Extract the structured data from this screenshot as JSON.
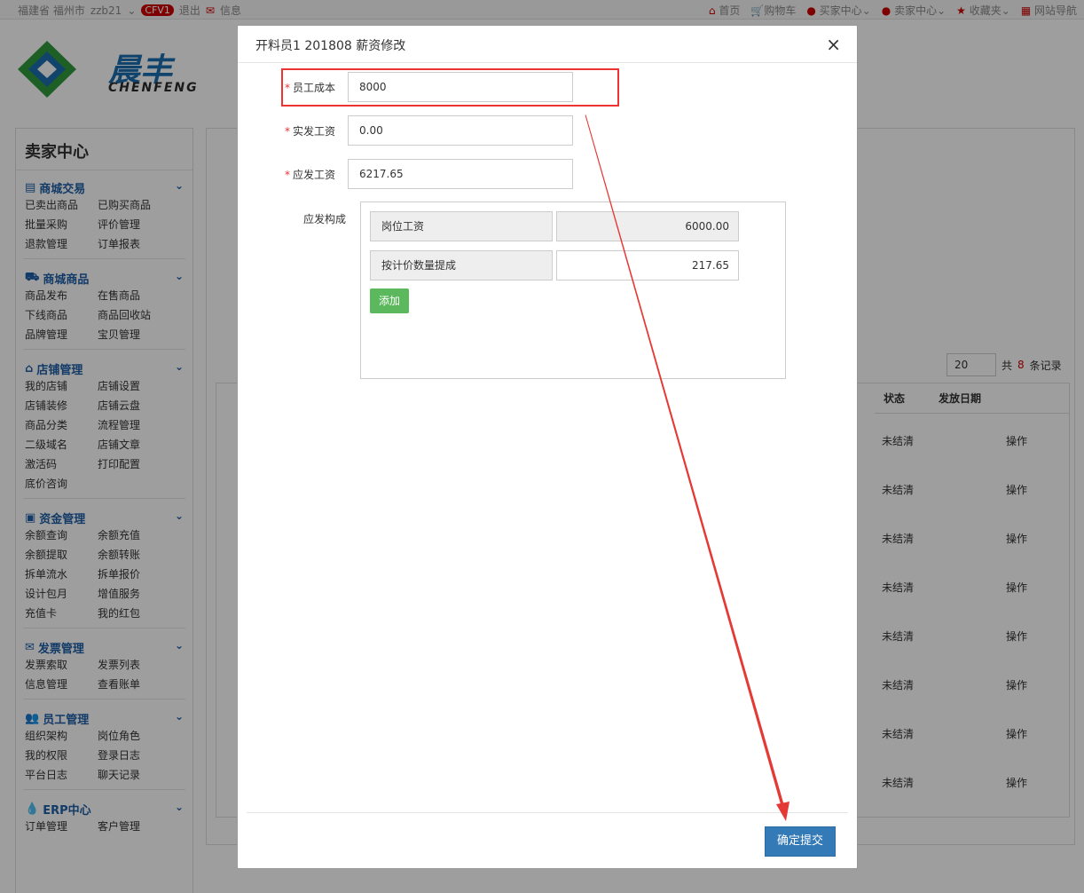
{
  "topbar": {
    "location": "福建省 福州市",
    "user": "zzb21",
    "level": "CFV1",
    "logout": "退出",
    "messages": "信息",
    "right_links": [
      "首页",
      "购物车",
      "买家中心",
      "卖家中心",
      "收藏夹",
      "网站导航"
    ]
  },
  "logo": {
    "cn": "晨丰",
    "en": "CHENFENG"
  },
  "sidebar": {
    "title": "卖家中心",
    "sections": [
      {
        "title": "商城交易",
        "icon": "list-icon",
        "items": [
          "已卖出商品",
          "已购买商品",
          "批量采购",
          "评价管理",
          "退款管理",
          "订单报表"
        ]
      },
      {
        "title": "商城商品",
        "icon": "truck-icon",
        "items": [
          "商品发布",
          "在售商品",
          "下线商品",
          "商品回收站",
          "品牌管理",
          "宝贝管理"
        ]
      },
      {
        "title": "店铺管理",
        "icon": "home-icon",
        "items": [
          "我的店铺",
          "店铺设置",
          "店铺装修",
          "店铺云盘",
          "商品分类",
          "流程管理",
          "二级域名",
          "店铺文章",
          "激活码",
          "打印配置",
          "底价咨询"
        ]
      },
      {
        "title": "资金管理",
        "icon": "money-icon",
        "items": [
          "余额查询",
          "余额充值",
          "余额提取",
          "余额转账",
          "拆单流水",
          "拆单报价",
          "设计包月",
          "增值服务",
          "充值卡",
          "我的红包"
        ]
      },
      {
        "title": "发票管理",
        "icon": "envelope-icon",
        "items": [
          "发票索取",
          "发票列表",
          "信息管理",
          "查看账单"
        ]
      },
      {
        "title": "员工管理",
        "icon": "users-icon",
        "items": [
          "组织架构",
          "岗位角色",
          "我的权限",
          "登录日志",
          "平台日志",
          "聊天记录"
        ]
      },
      {
        "title": "ERP中心",
        "icon": "drop-icon",
        "items": [
          "订单管理",
          "客户管理"
        ]
      }
    ]
  },
  "background_table": {
    "page_size": "20",
    "total_prefix": "共",
    "total": "8",
    "total_suffix": "条记录",
    "headers": [
      "状态",
      "发放日期"
    ],
    "status_values": [
      "未结清",
      "未结清",
      "未结清",
      "未结清",
      "未结清",
      "未结清",
      "未结清",
      "未结清"
    ],
    "action_label": "操作"
  },
  "modal": {
    "title": "开料员1 201808 薪资修改",
    "fields": [
      {
        "label": "员工成本",
        "value": "8000"
      },
      {
        "label": "实发工资",
        "value": "0.00"
      },
      {
        "label": "应发工资",
        "value": "6217.65"
      }
    ],
    "composition_label": "应发构成",
    "composition": [
      {
        "name": "岗位工资",
        "value": "6000.00"
      },
      {
        "name": "按计价数量提成",
        "value": "217.65"
      }
    ],
    "add_label": "添加",
    "submit_label": "确定提交"
  },
  "colors": {
    "highlight": "#e33333",
    "primary": "#337ab7",
    "success": "#5cb85c"
  }
}
